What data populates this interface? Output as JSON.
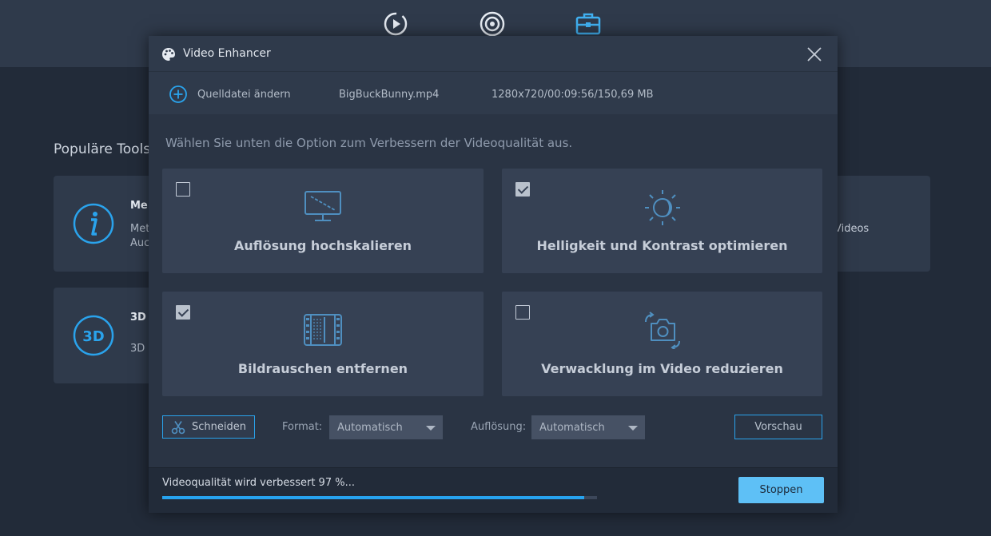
{
  "background": {
    "section_title": "Populäre Tools",
    "cards": [
      {
        "title": "Me",
        "line1": "Met",
        "line2": "Auc"
      },
      {
        "title": "3D",
        "line1": "3D "
      },
      {
        "line1": "Videos"
      }
    ]
  },
  "dialog": {
    "title": "Video Enhancer",
    "source": {
      "change_label": "Quelldatei ändern",
      "file_name": "BigBuckBunny.mp4",
      "file_info": "1280x720/00:09:56/150,69 MB"
    },
    "instruction": "Wählen Sie unten die Option zum Verbessern der Videoqualität aus.",
    "options": [
      {
        "label": "Auflösung hochskalieren",
        "checked": false
      },
      {
        "label": "Helligkeit und Kontrast optimieren",
        "checked": true
      },
      {
        "label": "Bildrauschen entfernen",
        "checked": true
      },
      {
        "label": "Verwacklung im Video reduzieren",
        "checked": false
      }
    ],
    "toolbar": {
      "cut_label": "Schneiden",
      "format_label": "Format:",
      "format_value": "Automatisch",
      "resolution_label": "Auflösung:",
      "resolution_value": "Automatisch",
      "preview_label": "Vorschau"
    },
    "progress": {
      "text": "Videoqualität wird verbessert 97 %...",
      "percent": 97,
      "stop_label": "Stoppen"
    }
  },
  "colors": {
    "accent": "#2aa3ec",
    "progress_fill": "#27a3ef",
    "stop_button": "#5ec0f6"
  }
}
